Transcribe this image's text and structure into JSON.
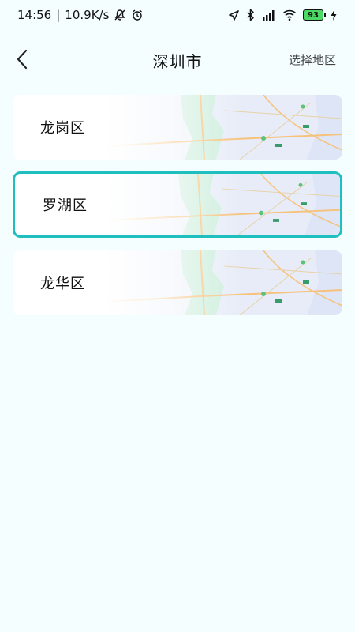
{
  "status": {
    "time": "14:56",
    "speed": "10.9K/s",
    "battery": "93"
  },
  "header": {
    "title": "深圳市",
    "action": "选择地区"
  },
  "districts": [
    {
      "name": "龙岗区",
      "selected": false
    },
    {
      "name": "罗湖区",
      "selected": true
    },
    {
      "name": "龙华区",
      "selected": false
    }
  ],
  "colors": {
    "background": "#f5fefe",
    "selected_border": "#1fbfbf"
  }
}
